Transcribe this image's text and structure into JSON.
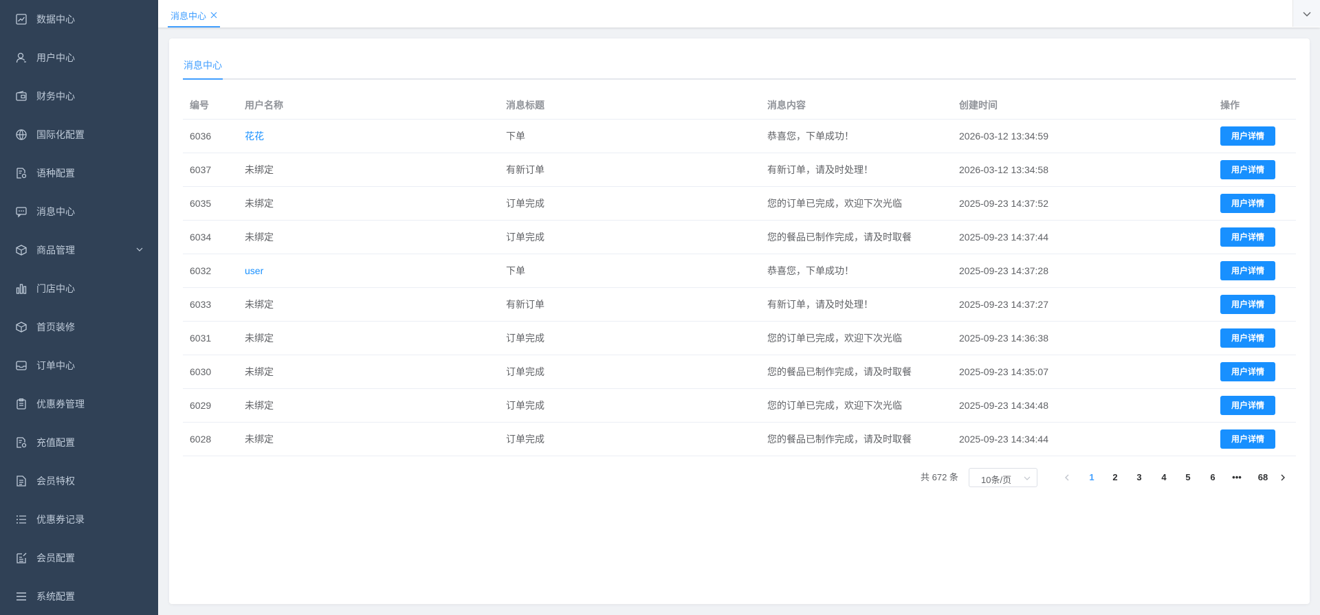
{
  "sidebar": {
    "items": [
      {
        "label": "数据中心",
        "icon": "chart-line-icon"
      },
      {
        "label": "用户中心",
        "icon": "user-icon"
      },
      {
        "label": "财务中心",
        "icon": "wallet-icon"
      },
      {
        "label": "国际化配置",
        "icon": "globe-icon"
      },
      {
        "label": "语种配置",
        "icon": "document-settings-icon"
      },
      {
        "label": "消息中心",
        "icon": "message-icon"
      },
      {
        "label": "商品管理",
        "icon": "box-icon"
      },
      {
        "label": "门店中心",
        "icon": "bar-chart-icon"
      },
      {
        "label": "首页装修",
        "icon": "cube-icon"
      },
      {
        "label": "订单中心",
        "icon": "inbox-icon"
      },
      {
        "label": "优惠券管理",
        "icon": "clipboard-icon"
      },
      {
        "label": "充值配置",
        "icon": "document-settings-icon"
      },
      {
        "label": "会员特权",
        "icon": "document-icon"
      },
      {
        "label": "优惠券记录",
        "icon": "list-icon"
      },
      {
        "label": "会员配置",
        "icon": "edit-box-icon"
      },
      {
        "label": "系统配置",
        "icon": "menu-icon"
      }
    ]
  },
  "tabs": {
    "active": "消息中心"
  },
  "page": {
    "tab_label": "消息中心"
  },
  "table": {
    "headers": [
      "编号",
      "用户名称",
      "消息标题",
      "消息内容",
      "创建时间",
      "操作"
    ],
    "action_label": "用户详情",
    "rows": [
      {
        "id": "6036",
        "user": "花花",
        "user_link": true,
        "title": "下单",
        "content": "恭喜您，下单成功！",
        "time": "2026-03-12 13:34:59"
      },
      {
        "id": "6037",
        "user": "未绑定",
        "user_link": false,
        "title": "有新订单",
        "content": "有新订单，请及时处理！",
        "time": "2026-03-12 13:34:58"
      },
      {
        "id": "6035",
        "user": "未绑定",
        "user_link": false,
        "title": "订单完成",
        "content": "您的订单已完成，欢迎下次光临",
        "time": "2025-09-23 14:37:52"
      },
      {
        "id": "6034",
        "user": "未绑定",
        "user_link": false,
        "title": "订单完成",
        "content": "您的餐品已制作完成，请及时取餐",
        "time": "2025-09-23 14:37:44"
      },
      {
        "id": "6032",
        "user": "user",
        "user_link": true,
        "title": "下单",
        "content": "恭喜您，下单成功！",
        "time": "2025-09-23 14:37:28"
      },
      {
        "id": "6033",
        "user": "未绑定",
        "user_link": false,
        "title": "有新订单",
        "content": "有新订单，请及时处理！",
        "time": "2025-09-23 14:37:27"
      },
      {
        "id": "6031",
        "user": "未绑定",
        "user_link": false,
        "title": "订单完成",
        "content": "您的订单已完成，欢迎下次光临",
        "time": "2025-09-23 14:36:38"
      },
      {
        "id": "6030",
        "user": "未绑定",
        "user_link": false,
        "title": "订单完成",
        "content": "您的餐品已制作完成，请及时取餐",
        "time": "2025-09-23 14:35:07"
      },
      {
        "id": "6029",
        "user": "未绑定",
        "user_link": false,
        "title": "订单完成",
        "content": "您的订单已完成，欢迎下次光临",
        "time": "2025-09-23 14:34:48"
      },
      {
        "id": "6028",
        "user": "未绑定",
        "user_link": false,
        "title": "订单完成",
        "content": "您的餐品已制作完成，请及时取餐",
        "time": "2025-09-23 14:34:44"
      }
    ]
  },
  "pagination": {
    "total_text": "共 672 条",
    "page_size": "10条/页",
    "pages": [
      "1",
      "2",
      "3",
      "4",
      "5",
      "6",
      "•••",
      "68"
    ],
    "current": "1"
  }
}
